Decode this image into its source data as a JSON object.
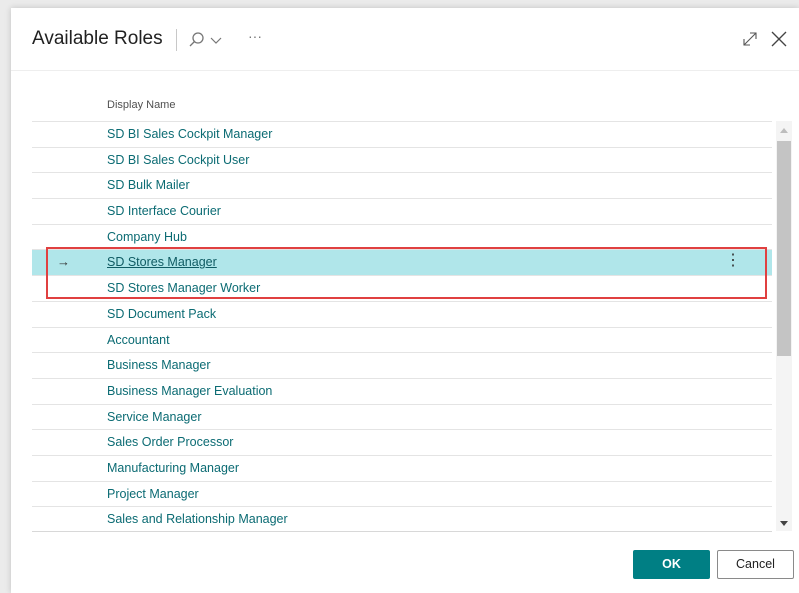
{
  "dialog": {
    "title": "Available Roles",
    "more_label": "···"
  },
  "list": {
    "column_header": "Display Name",
    "selected_index": 5,
    "items": [
      "SD BI Sales Cockpit Manager",
      "SD BI Sales Cockpit User",
      "SD Bulk Mailer",
      "SD Interface Courier",
      "Company Hub",
      "SD Stores Manager",
      "SD Stores Manager Worker",
      "SD Document Pack",
      "Accountant",
      "Business Manager",
      "Business Manager Evaluation",
      "Service Manager",
      "Sales Order Processor",
      "Manufacturing Manager",
      "Project Manager",
      "Sales and Relationship Manager"
    ],
    "arrow_glyph": "→",
    "kebab_glyph": "⋮"
  },
  "footer": {
    "ok_label": "OK",
    "cancel_label": "Cancel"
  },
  "icons": {
    "search": "search-icon",
    "chevron": "chevron-down-icon",
    "expand": "expand-icon",
    "close": "close-icon"
  },
  "colors": {
    "accent": "#007f84",
    "link": "#0b6b73",
    "selected_row": "#b0e6ea",
    "highlight_border": "#e04040"
  }
}
